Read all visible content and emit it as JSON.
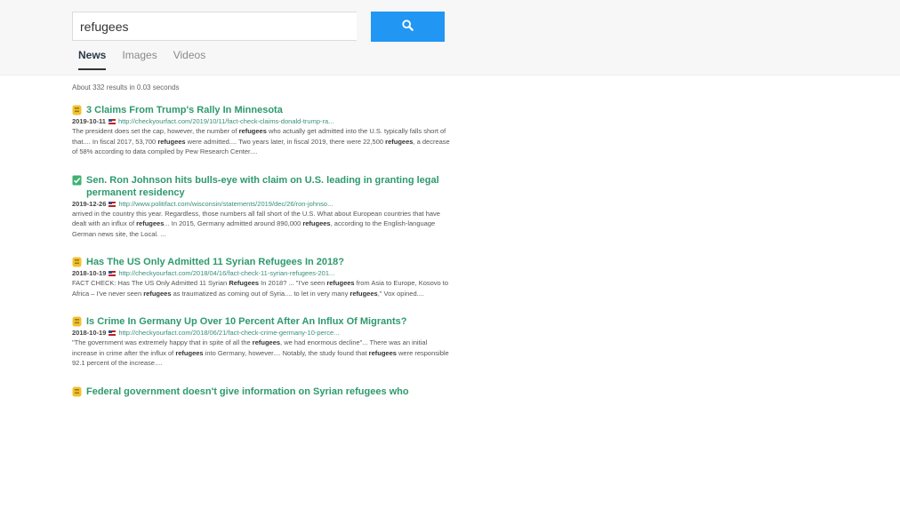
{
  "search": {
    "value": "refugees"
  },
  "tabs": [
    {
      "label": "News",
      "active": true
    },
    {
      "label": "Images",
      "active": false
    },
    {
      "label": "Videos",
      "active": false
    }
  ],
  "stats": "About 332 results in 0.03 seconds",
  "results": [
    {
      "rating": "yellow-face-icon",
      "title": "3 Claims From Trump's Rally In Minnesota",
      "date": "2019-10-11",
      "url": "http://checkyourfact.com/2019/10/11/fact-check-claims-donald-trump-ra...",
      "snippet_parts": [
        "The president does set the cap, however, the number of ",
        "refugees",
        " who actually get admitted into the U.S. typically falls short of that.... In fiscal 2017, 53,700 ",
        "refugees",
        " were admitted.... Two years later, in fiscal 2019, there were 22,500 ",
        "refugees",
        ", a decrease of 58% according to data compiled by Pew Research Center...."
      ]
    },
    {
      "rating": "green-check-icon",
      "title": "Sen. Ron Johnson hits bulls-eye with claim on U.S. leading in granting legal permanent residency",
      "date": "2019-12-26",
      "url": "http://www.politifact.com/wisconsin/statements/2019/dec/26/ron-johnso...",
      "snippet_parts": [
        "arrived in the country this year. Regardless, those numbers all fall short of the U.S. What about European countries that have dealt with an influx of ",
        "refugees",
        "... In 2015, Germany admitted around 890,000 ",
        "refugees",
        ", according to the English-language German news site, the Local. ..."
      ]
    },
    {
      "rating": "yellow-face-icon",
      "title": "Has The US Only Admitted 11 Syrian Refugees In 2018?",
      "date": "2018-10-19",
      "url": "http://checkyourfact.com/2018/04/16/fact-check-11-syrian-refugees-201...",
      "snippet_parts": [
        "FACT CHECK: Has The US Only Admitted 11 Syrian ",
        "Refugees",
        " In 2018? ... \"I've seen ",
        "refugees",
        " from Asia to Europe, Kosovo to Africa – I've never seen ",
        "refugees",
        " as traumatized as coming out of Syria.... to let in very many ",
        "refugees",
        ",\" Vox opined...."
      ]
    },
    {
      "rating": "yellow-face-icon",
      "title": "Is Crime In Germany Up Over 10 Percent After An Influx Of Migrants?",
      "date": "2018-10-19",
      "url": "http://checkyourfact.com/2018/06/21/fact-check-crime-germany-10-perce...",
      "snippet_parts": [
        "\"The government was extremely happy that in spite of all the ",
        "refugees",
        ", we had enormous decline\"... There was an initial increase in crime after the influx of ",
        "refugees",
        " into Germany, however.... Notably, the study found that ",
        "refugees",
        " were responsible 92.1 percent of the increase...."
      ]
    },
    {
      "rating": "yellow-face-icon",
      "title": "Federal government doesn't give information on Syrian refugees who",
      "date": "",
      "url": "",
      "snippet_parts": []
    }
  ],
  "colors": {
    "accent": "#2196f3",
    "title": "#2d9a6d",
    "url": "#3a8f7a"
  }
}
